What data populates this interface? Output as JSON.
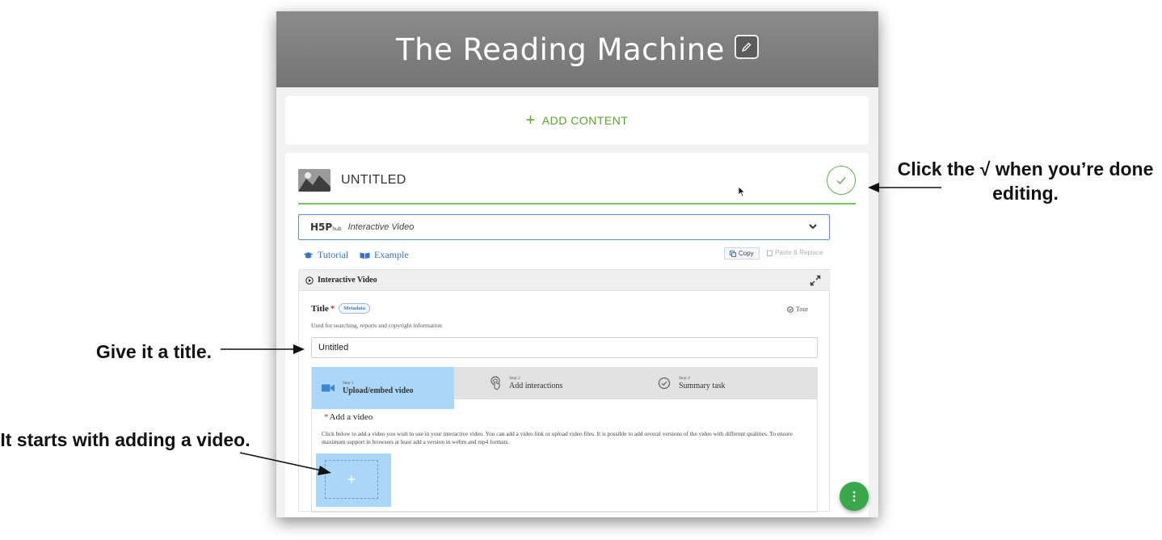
{
  "annotations": {
    "done_editing": "Click the √ when you’re done editing.",
    "give_title": "Give it a title.",
    "add_video": "It starts with adding a video."
  },
  "app": {
    "title": "The Reading Machine",
    "add_content": "ADD CONTENT"
  },
  "content": {
    "title": "UNTITLED",
    "content_type": "Interactive Video",
    "h5p_logo": "H5P",
    "h5p_logo_suffix": "hub",
    "tutorial": "Tutorial",
    "example": "Example",
    "copy": "Copy",
    "paste_replace": "Paste & Replace",
    "panel_title": "Interactive Video",
    "field_title_label": "Title",
    "metadata": "Metadata",
    "tour": "Tour",
    "field_title_desc": "Used for searching, reports and copyright information",
    "title_value": "Untitled",
    "steps": [
      {
        "num": "Step 1",
        "label": "Upload/embed video"
      },
      {
        "num": "Step 2",
        "label": "Add interactions"
      },
      {
        "num": "Step 3",
        "label": "Summary task"
      }
    ],
    "add_video_label": "Add a video",
    "add_video_desc": "Click below to add a video you wish to use in your interactive video. You can add a video link or upload video files. It is possible to add several versions of the video with different qualities. To ensure maximum support in browsers at least add a version in webm and mp4 formats.",
    "upload_plus": "+"
  },
  "icons": {
    "edit": "pencil-icon",
    "done": "check-icon",
    "fab": "more-vertical-icon",
    "step1": "video-camera-icon",
    "step2": "touch-icon",
    "step3": "check-circle-icon"
  },
  "colors": {
    "header_gray": "#7d7d7d",
    "accent_green": "#5aa32c",
    "link_blue": "#3a76b8",
    "active_step": "#abd6f7",
    "fab_green": "#3aa84a"
  }
}
